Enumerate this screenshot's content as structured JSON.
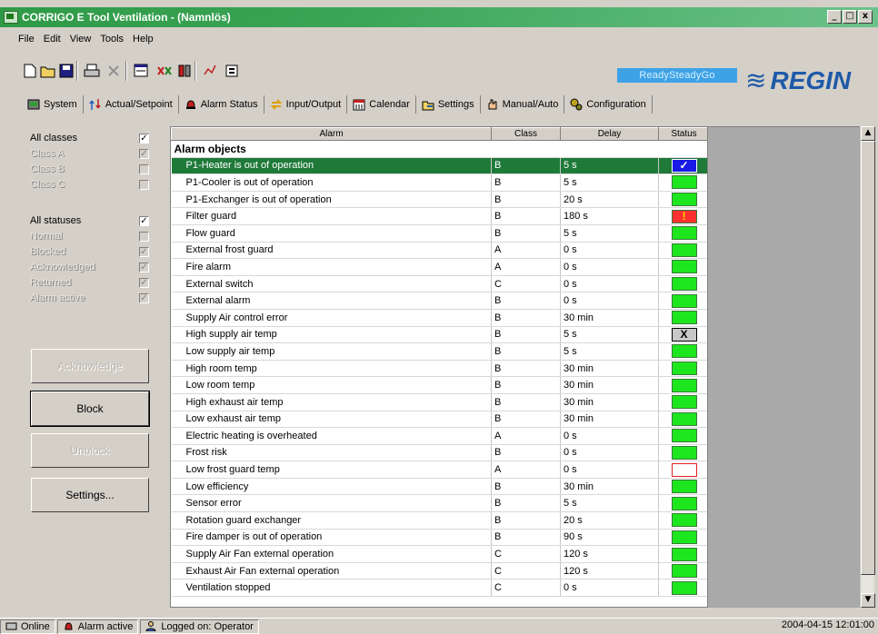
{
  "window": {
    "title": "CORRIGO E Tool Ventilation - (Namnlös)",
    "buttons": [
      "_",
      "□",
      "x"
    ]
  },
  "menu": [
    "File",
    "Edit",
    "View",
    "Tools",
    "Help"
  ],
  "brand": {
    "rsg": "ReadySteadyGo",
    "logo": "REGIN",
    "wave_glyph": "≋"
  },
  "tabs": [
    {
      "label": "System",
      "icon": "system-icon"
    },
    {
      "label": "Actual/Setpoint",
      "icon": "setpoint-icon"
    },
    {
      "label": "Alarm Status",
      "icon": "alarm-bell-icon"
    },
    {
      "label": "Input/Output",
      "icon": "io-arrows-icon"
    },
    {
      "label": "Calendar",
      "icon": "calendar-icon"
    },
    {
      "label": "Settings",
      "icon": "settings-icon"
    },
    {
      "label": "Manual/Auto",
      "icon": "hand-icon"
    },
    {
      "label": "Configuration",
      "icon": "configuration-icon"
    }
  ],
  "filters": {
    "classes": [
      {
        "label": "All classes",
        "checked": true,
        "enabled": true
      },
      {
        "label": "Class A",
        "checked": true,
        "enabled": false
      },
      {
        "label": "Class B",
        "checked": false,
        "enabled": false
      },
      {
        "label": "Class C",
        "checked": false,
        "enabled": false
      }
    ],
    "statuses": [
      {
        "label": "All statuses",
        "checked": true,
        "enabled": true
      },
      {
        "label": "Normal",
        "checked": false,
        "enabled": false
      },
      {
        "label": "Blocked",
        "checked": true,
        "enabled": false
      },
      {
        "label": "Acknowledged",
        "checked": true,
        "enabled": false
      },
      {
        "label": "Returned",
        "checked": true,
        "enabled": false
      },
      {
        "label": "Alarm active",
        "checked": true,
        "enabled": false
      }
    ]
  },
  "actions": {
    "acknowledge": "Acknowledge",
    "block": "Block",
    "unblock": "Unblock",
    "settings": "Settings..."
  },
  "table": {
    "headers": [
      "Alarm",
      "Class",
      "Delay",
      "Status"
    ],
    "section": "Alarm objects",
    "rows": [
      {
        "alarm": "P1-Heater is out of operation",
        "class": "B",
        "delay": "5 s",
        "status": "acknowledged",
        "selected": true
      },
      {
        "alarm": "P1-Cooler is out of operation",
        "class": "B",
        "delay": "5 s",
        "status": "normal"
      },
      {
        "alarm": "P1-Exchanger is out of operation",
        "class": "B",
        "delay": "20 s",
        "status": "normal"
      },
      {
        "alarm": "Filter guard",
        "class": "B",
        "delay": "180 s",
        "status": "alarm"
      },
      {
        "alarm": "Flow guard",
        "class": "B",
        "delay": "5 s",
        "status": "normal"
      },
      {
        "alarm": "External frost guard",
        "class": "A",
        "delay": "0 s",
        "status": "normal"
      },
      {
        "alarm": "Fire alarm",
        "class": "A",
        "delay": "0 s",
        "status": "normal"
      },
      {
        "alarm": "External switch",
        "class": "C",
        "delay": "0 s",
        "status": "normal"
      },
      {
        "alarm": "External alarm",
        "class": "B",
        "delay": "0 s",
        "status": "normal"
      },
      {
        "alarm": "Supply Air control error",
        "class": "B",
        "delay": "30 min",
        "status": "normal"
      },
      {
        "alarm": "High supply air temp",
        "class": "B",
        "delay": "5 s",
        "status": "blocked"
      },
      {
        "alarm": "Low supply air temp",
        "class": "B",
        "delay": "5 s",
        "status": "normal"
      },
      {
        "alarm": "High room temp",
        "class": "B",
        "delay": "30 min",
        "status": "normal"
      },
      {
        "alarm": "Low room temp",
        "class": "B",
        "delay": "30 min",
        "status": "normal"
      },
      {
        "alarm": "High exhaust air temp",
        "class": "B",
        "delay": "30 min",
        "status": "normal"
      },
      {
        "alarm": "Low exhaust air temp",
        "class": "B",
        "delay": "30 min",
        "status": "normal"
      },
      {
        "alarm": "Electric heating is overheated",
        "class": "A",
        "delay": "0 s",
        "status": "normal"
      },
      {
        "alarm": "Frost risk",
        "class": "B",
        "delay": "0 s",
        "status": "normal"
      },
      {
        "alarm": "Low frost guard temp",
        "class": "A",
        "delay": "0 s",
        "status": "returned"
      },
      {
        "alarm": "Low efficiency",
        "class": "B",
        "delay": "30 min",
        "status": "normal"
      },
      {
        "alarm": "Sensor error",
        "class": "B",
        "delay": "5 s",
        "status": "normal"
      },
      {
        "alarm": "Rotation guard exchanger",
        "class": "B",
        "delay": "20 s",
        "status": "normal"
      },
      {
        "alarm": "Fire damper is out of operation",
        "class": "B",
        "delay": "90 s",
        "status": "normal"
      },
      {
        "alarm": "Supply Air Fan external operation",
        "class": "C",
        "delay": "120 s",
        "status": "normal"
      },
      {
        "alarm": "Exhaust Air Fan external operation",
        "class": "C",
        "delay": "120 s",
        "status": "normal"
      },
      {
        "alarm": "Ventilation stopped",
        "class": "C",
        "delay": "0 s",
        "status": "normal"
      }
    ]
  },
  "status_glyphs": {
    "acknowledged": "✓",
    "alarm": "!",
    "blocked": "X"
  },
  "statusbar": {
    "online": "Online",
    "alarm_active": "Alarm active",
    "logged_on": "Logged on: Operator",
    "datetime": "2004-04-15  12:01:00"
  }
}
